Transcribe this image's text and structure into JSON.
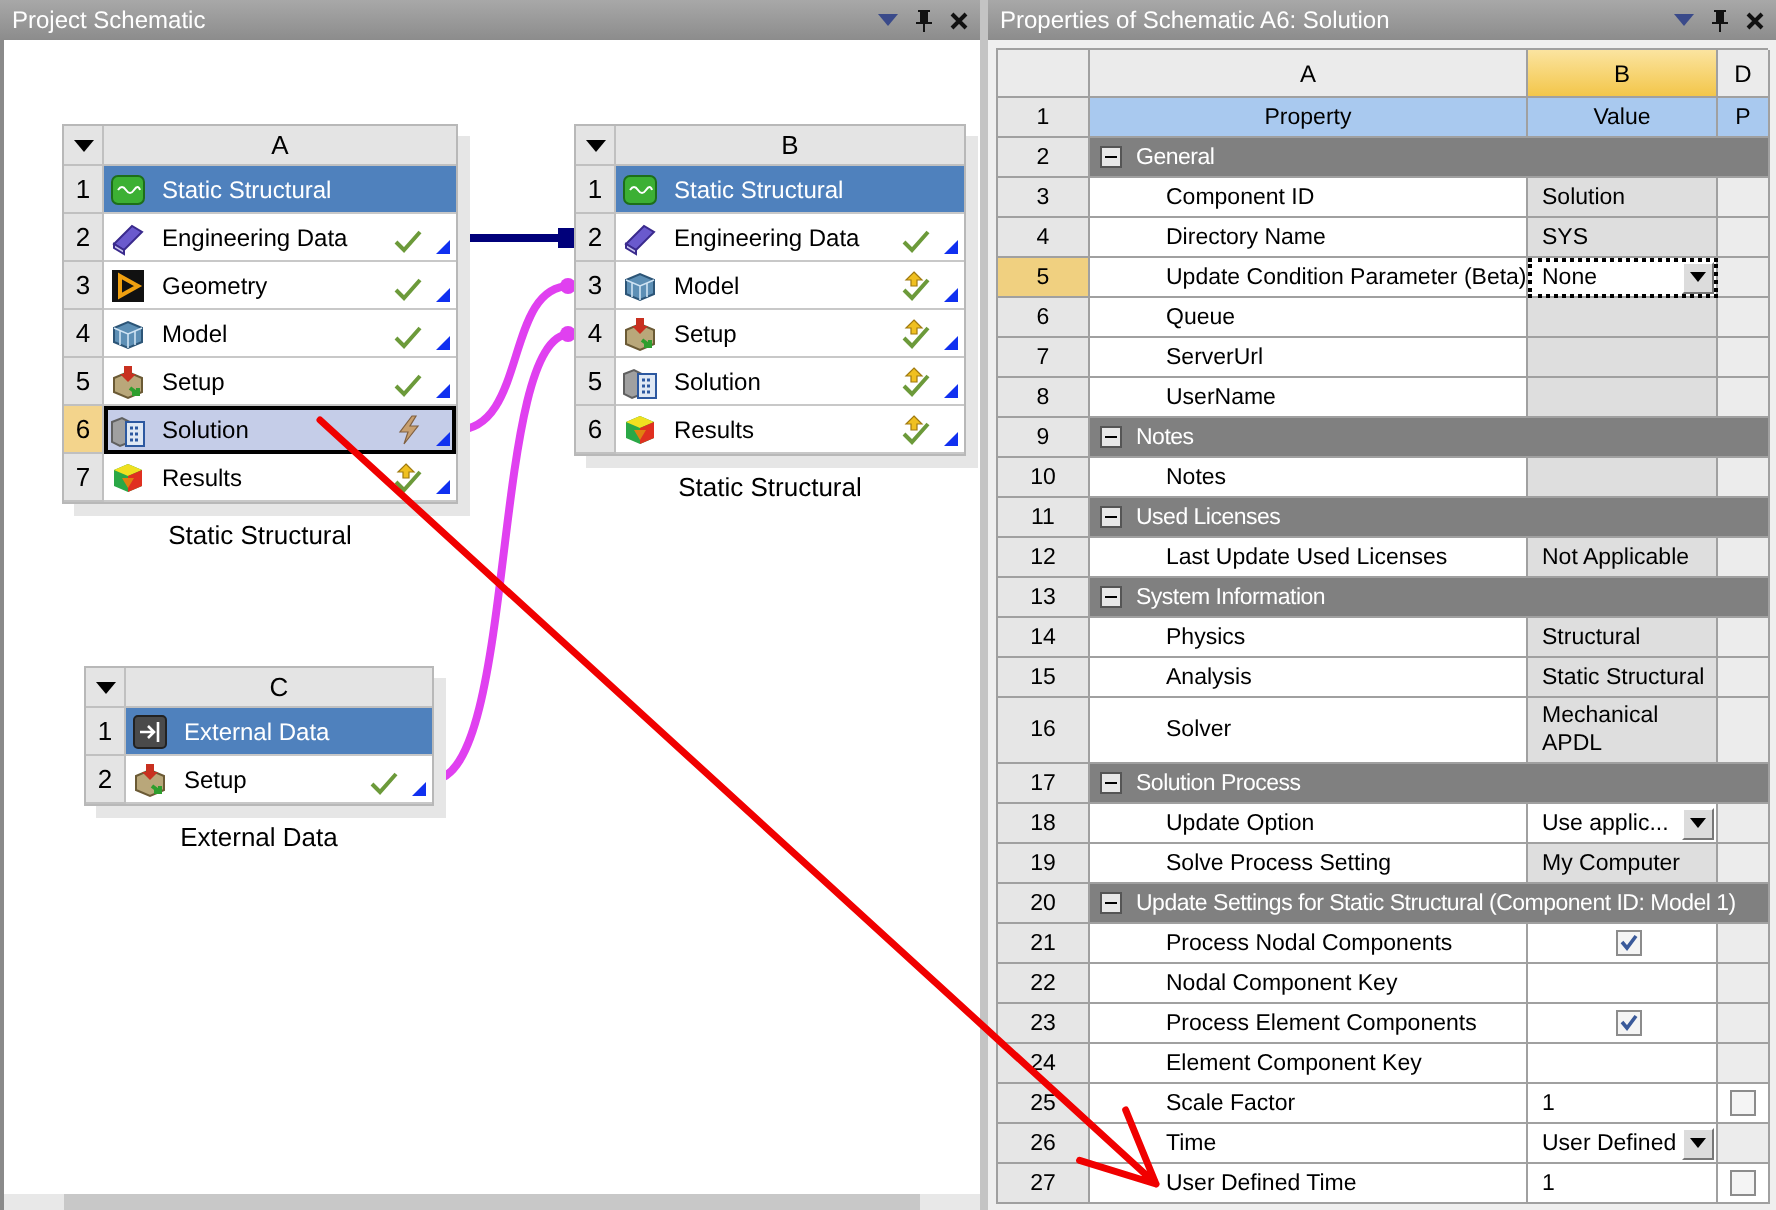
{
  "schematic": {
    "title": "Project Schematic",
    "systems": [
      {
        "letter": "A",
        "caption": "Static Structural",
        "cells": [
          {
            "number": "1",
            "label": "Static Structural",
            "kind": "system",
            "selected": false
          },
          {
            "number": "2",
            "label": "Engineering Data",
            "kind": "book",
            "complete": true,
            "upstream_changed": false,
            "selected": false
          },
          {
            "number": "3",
            "label": "Geometry",
            "kind": "geometry",
            "complete": true,
            "upstream_changed": false,
            "selected": false
          },
          {
            "number": "4",
            "label": "Model",
            "kind": "model",
            "complete": true,
            "upstream_changed": false,
            "selected": false
          },
          {
            "number": "5",
            "label": "Setup",
            "kind": "setup",
            "complete": true,
            "upstream_changed": false,
            "selected": false
          },
          {
            "number": "6",
            "label": "Solution",
            "kind": "solution",
            "complete": false,
            "selected": true
          },
          {
            "number": "7",
            "label": "Results",
            "kind": "results",
            "complete": true,
            "upstream_changed": true,
            "selected": false
          }
        ]
      },
      {
        "letter": "B",
        "caption": "Static Structural",
        "cells": [
          {
            "number": "1",
            "label": "Static Structural",
            "kind": "system",
            "selected": false
          },
          {
            "number": "2",
            "label": "Engineering Data",
            "kind": "book",
            "complete": true,
            "upstream_changed": false,
            "selected": false
          },
          {
            "number": "3",
            "label": "Model",
            "kind": "model",
            "complete": true,
            "upstream_changed": true,
            "selected": false
          },
          {
            "number": "4",
            "label": "Setup",
            "kind": "setup",
            "complete": true,
            "upstream_changed": true,
            "selected": false
          },
          {
            "number": "5",
            "label": "Solution",
            "kind": "solution",
            "complete": true,
            "upstream_changed": true,
            "selected": false
          },
          {
            "number": "6",
            "label": "Results",
            "kind": "results",
            "complete": true,
            "upstream_changed": true,
            "selected": false
          }
        ]
      },
      {
        "letter": "C",
        "caption": "External Data",
        "cells": [
          {
            "number": "1",
            "label": "External Data",
            "kind": "external",
            "selected": false
          },
          {
            "number": "2",
            "label": "Setup",
            "kind": "setup",
            "complete": true,
            "upstream_changed": false,
            "selected": false
          }
        ]
      }
    ],
    "links": [
      {
        "kind": "share"
      },
      {
        "kind": "transfer"
      },
      {
        "kind": "transfer"
      }
    ]
  },
  "properties": {
    "title": "Properties of Schematic A6: Solution",
    "columns": [
      {
        "label": "A",
        "selected": false
      },
      {
        "label": "B",
        "selected": true
      },
      {
        "label": "D",
        "selected": false
      }
    ],
    "rows": [
      {
        "number": "1",
        "kind": "heading",
        "cells": [
          "Property",
          "Value",
          "P"
        ],
        "selected": false
      },
      {
        "number": "2",
        "kind": "group",
        "label": "General",
        "expanded": true,
        "selected": false
      },
      {
        "number": "3",
        "kind": "text",
        "property": "Component ID",
        "value": "Solution",
        "editable": false,
        "selected": false
      },
      {
        "number": "4",
        "kind": "text",
        "property": "Directory Name",
        "value": "SYS",
        "editable": false,
        "selected": false
      },
      {
        "number": "5",
        "kind": "dropdown",
        "property": "Update Condition Parameter (Beta)",
        "value": "None",
        "editable": true,
        "selected": true
      },
      {
        "number": "6",
        "kind": "text",
        "property": "Queue",
        "editable": false,
        "selected": false
      },
      {
        "number": "7",
        "kind": "text",
        "property": "ServerUrl",
        "editable": false,
        "selected": false
      },
      {
        "number": "8",
        "kind": "text",
        "property": "UserName",
        "editable": false,
        "selected": false
      },
      {
        "number": "9",
        "kind": "group",
        "label": "Notes",
        "expanded": true,
        "selected": false
      },
      {
        "number": "10",
        "kind": "text",
        "property": "Notes",
        "editable": false,
        "selected": false
      },
      {
        "number": "11",
        "kind": "group",
        "label": "Used Licenses",
        "expanded": true,
        "selected": false
      },
      {
        "number": "12",
        "kind": "text",
        "property": "Last Update Used Licenses",
        "value": "Not Applicable",
        "editable": false,
        "selected": false
      },
      {
        "number": "13",
        "kind": "group",
        "label": "System Information",
        "expanded": true,
        "selected": false
      },
      {
        "number": "14",
        "kind": "text",
        "property": "Physics",
        "value": "Structural",
        "editable": false,
        "selected": false
      },
      {
        "number": "15",
        "kind": "text",
        "property": "Analysis",
        "value": "Static Structural",
        "editable": false,
        "selected": false
      },
      {
        "number": "16",
        "kind": "text",
        "property": "Solver",
        "value": "Mechanical\nAPDL",
        "editable": false,
        "selected": false
      },
      {
        "number": "17",
        "kind": "group",
        "label": "Solution Process",
        "expanded": true,
        "selected": false
      },
      {
        "number": "18",
        "kind": "dropdown",
        "property": "Update Option",
        "value": "Use applic...",
        "editable": true,
        "selected": false
      },
      {
        "number": "19",
        "kind": "text",
        "property": "Solve Process Setting",
        "value": "My Computer",
        "editable": false,
        "selected": false
      },
      {
        "number": "20",
        "kind": "group",
        "label": "Update Settings for Static Structural (Component ID: Model 1)",
        "expanded": true,
        "selected": false
      },
      {
        "number": "21",
        "kind": "checkbox",
        "property": "Process Nodal Components",
        "checked": true,
        "editable": true,
        "selected": false
      },
      {
        "number": "22",
        "kind": "text",
        "property": "Nodal Component Key",
        "editable": true,
        "selected": false
      },
      {
        "number": "23",
        "kind": "checkbox",
        "property": "Process Element Components",
        "checked": true,
        "editable": true,
        "selected": false
      },
      {
        "number": "24",
        "kind": "text",
        "property": "Element Component Key",
        "editable": true,
        "selected": false
      },
      {
        "number": "25",
        "kind": "text",
        "property": "Scale Factor",
        "value": "1",
        "editable": true,
        "parameter": {
          "checked": false
        },
        "selected": false
      },
      {
        "number": "26",
        "kind": "dropdown",
        "property": "Time",
        "value": "User Defined",
        "editable": true,
        "selected": false
      },
      {
        "number": "27",
        "kind": "text",
        "property": "User Defined Time",
        "value": "1",
        "editable": true,
        "parameter": {
          "checked": false
        },
        "selected": false
      }
    ]
  }
}
